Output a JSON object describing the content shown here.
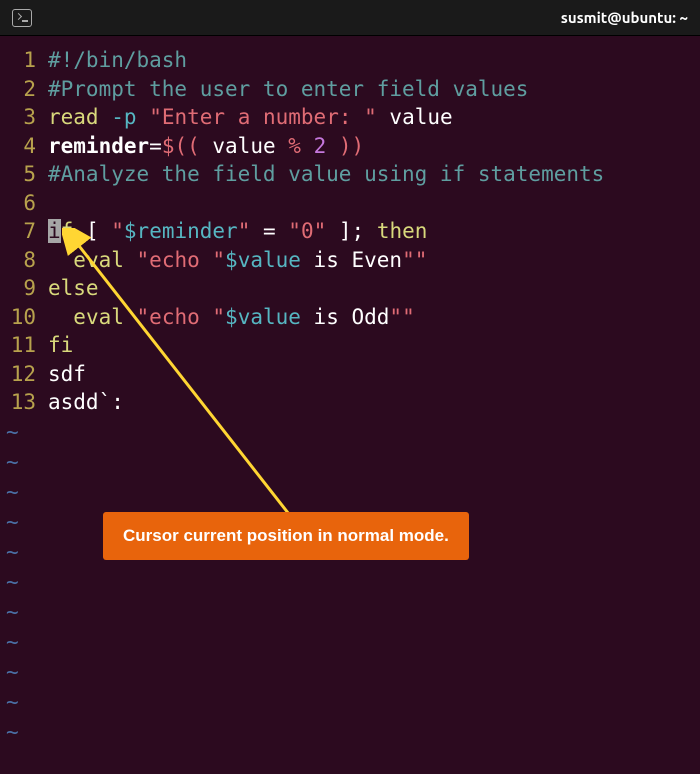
{
  "titlebar": {
    "title": "susmit@ubuntu: ~"
  },
  "lines": {
    "l1": {
      "num": "1",
      "text": "#!/bin/bash"
    },
    "l2": {
      "num": "2",
      "text": "#Prompt the user to enter field values"
    },
    "l3": {
      "num": "3",
      "read": "read",
      "flag": "-p",
      "str": "\"Enter a number: \"",
      "var": "value"
    },
    "l4": {
      "num": "4",
      "lhs": "reminder",
      "eq": "=",
      "d1": "$((",
      "v": " value ",
      "op": "% ",
      "n": "2",
      "d2": " ))"
    },
    "l5": {
      "num": "5",
      "text": "#Analyze the field value using if statements"
    },
    "l6": {
      "num": "6"
    },
    "l7": {
      "num": "7",
      "cursor": "i",
      "f": "f",
      "b1": " [ ",
      "q1": "\"",
      "var": "$reminder",
      "q2": "\"",
      "eq": " = ",
      "zero": "\"0\"",
      "b2": " ]; ",
      "then": "then"
    },
    "l8": {
      "num": "8",
      "indent": "  ",
      "eval": "eval",
      "q1": " \"",
      "echo": "echo ",
      "q2": "\"",
      "var": "$value",
      "txt": " is Even",
      "q3": "\"\""
    },
    "l9": {
      "num": "9",
      "else": "else"
    },
    "l10": {
      "num": "10",
      "indent": "  ",
      "eval": "eval",
      "q1": " \"",
      "echo": "echo ",
      "q2": "\"",
      "var": "$value",
      "txt": " is Odd",
      "q3": "\"\""
    },
    "l11": {
      "num": "11",
      "fi": "fi"
    },
    "l12": {
      "num": "12",
      "text": "sdf"
    },
    "l13": {
      "num": "13",
      "text": "asdd`:"
    }
  },
  "tilde": "~",
  "annotation": {
    "text": "Cursor current position in normal mode."
  },
  "chart_data": {
    "type": "code-editor",
    "editor": "vim",
    "mode": "normal",
    "cursor_line": 7,
    "cursor_col": 1,
    "title": "susmit@ubuntu: ~",
    "content": [
      "#!/bin/bash",
      "#Prompt the user to enter field values",
      "read -p \"Enter a number: \" value",
      "reminder=$(( value % 2 ))",
      "#Analyze the field value using if statements",
      "",
      "if [ \"$reminder\" = \"0\" ]; then",
      "  eval \"echo \"$value is Even\"\"",
      "else",
      "  eval \"echo \"$value is Odd\"\"",
      "fi",
      "sdf",
      "asdd`:"
    ],
    "annotation": "Cursor current position in normal mode."
  }
}
